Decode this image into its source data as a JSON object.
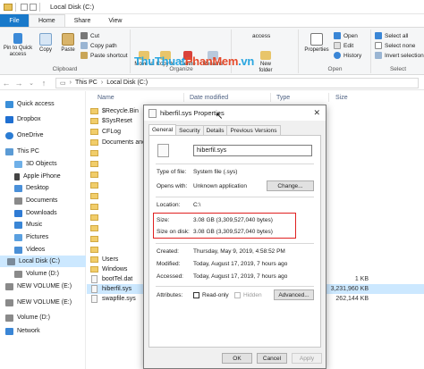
{
  "window": {
    "title": "Local Disk (C:)"
  },
  "ribbon_tabs": [
    "File",
    "Home",
    "Share",
    "View"
  ],
  "ribbon": {
    "clipboard": {
      "pin": "Pin to Quick access",
      "copy": "Copy",
      "paste": "Paste",
      "cut": "Cut",
      "copy_path": "Copy path",
      "paste_shortcut": "Paste shortcut",
      "label": "Clipboard"
    },
    "organize": {
      "move_to": "Move to",
      "copy_to": "Copy to",
      "delete": "Delete",
      "rename": "Rename",
      "label": "Organize"
    },
    "new": {
      "new_folder": "New folder",
      "easy_access": "access"
    },
    "open": {
      "properties": "Properties",
      "open": "Open",
      "edit": "Edit",
      "history": "History",
      "label": "Open"
    },
    "select": {
      "select_all": "Select all",
      "select_none": "Select none",
      "invert": "Invert selection",
      "label": "Select"
    },
    "watermark": {
      "a": "ThuThuat",
      "b": "PhanMem",
      "c": ".vn"
    }
  },
  "address": {
    "this_pc": "This PC",
    "local_disk": "Local Disk (C:)"
  },
  "nav": [
    {
      "label": "Quick access",
      "color": "#3b8fd9"
    },
    {
      "label": "Dropbox",
      "color": "#1f6fd1"
    },
    {
      "label": "OneDrive",
      "color": "#2b7cd3"
    },
    {
      "label": "This PC",
      "color": "#5b9bd5"
    },
    {
      "label": "3D Objects",
      "color": "#6fb0e8"
    },
    {
      "label": "Apple iPhone",
      "color": "#444444"
    },
    {
      "label": "Desktop",
      "color": "#4a90d9"
    },
    {
      "label": "Documents",
      "color": "#8a8a8a"
    },
    {
      "label": "Downloads",
      "color": "#2f7bd4"
    },
    {
      "label": "Music",
      "color": "#3a86d6"
    },
    {
      "label": "Pictures",
      "color": "#5aa0e0"
    },
    {
      "label": "Videos",
      "color": "#4a8fd6"
    },
    {
      "label": "Local Disk (C:)",
      "color": "#7a8a9a"
    },
    {
      "label": "Volume (D:)",
      "color": "#8a8a8a"
    },
    {
      "label": "NEW VOLUME (E:)",
      "color": "#8a8a8a"
    },
    {
      "label": "NEW VOLUME (E:)",
      "color": "#8a8a8a"
    },
    {
      "label": "Volume (D:)",
      "color": "#8a8a8a"
    },
    {
      "label": "Network",
      "color": "#3a86d6"
    }
  ],
  "columns": {
    "name": "Name",
    "date": "Date modified",
    "type": "Type",
    "size": "Size"
  },
  "files": [
    {
      "name": "$Recycle.Bin",
      "kind": "folder",
      "size": ""
    },
    {
      "name": "$SysReset",
      "kind": "folder",
      "size": ""
    },
    {
      "name": "CFLog",
      "kind": "folder",
      "size": ""
    },
    {
      "name": "Documents and Se",
      "kind": "folder",
      "size": ""
    },
    {
      "name": "",
      "kind": "folder",
      "size": ""
    },
    {
      "name": "",
      "kind": "folder",
      "size": ""
    },
    {
      "name": "",
      "kind": "folder",
      "size": ""
    },
    {
      "name": "",
      "kind": "folder",
      "size": ""
    },
    {
      "name": "",
      "kind": "folder",
      "size": ""
    },
    {
      "name": "",
      "kind": "folder",
      "size": ""
    },
    {
      "name": "",
      "kind": "folder",
      "size": ""
    },
    {
      "name": "",
      "kind": "folder",
      "size": ""
    },
    {
      "name": "",
      "kind": "folder",
      "size": ""
    },
    {
      "name": "",
      "kind": "folder",
      "size": ""
    },
    {
      "name": "Users",
      "kind": "folder",
      "size": ""
    },
    {
      "name": "Windows",
      "kind": "folder",
      "size": ""
    },
    {
      "name": "bootTel.dat",
      "kind": "file",
      "size": "1 KB"
    },
    {
      "name": "hiberfil.sys",
      "kind": "file",
      "size": "3,231,960 KB"
    },
    {
      "name": "swapfile.sys",
      "kind": "file",
      "size": "262,144 KB"
    }
  ],
  "dialog": {
    "title": "hiberfil.sys Properties",
    "close": "✕",
    "tabs": [
      "General",
      "Security",
      "Details",
      "Previous Versions"
    ],
    "filename": "hiberfil.sys",
    "type_label": "Type of file:",
    "type_value": "System file (.sys)",
    "opens_label": "Opens with:",
    "opens_value": "Unknown application",
    "change_btn": "Change...",
    "location_label": "Location:",
    "location_value": "C:\\",
    "size_label": "Size:",
    "size_value": "3.08 GB (3,309,527,040 bytes)",
    "disk_label": "Size on disk:",
    "disk_value": "3.08 GB (3,309,527,040 bytes)",
    "created_label": "Created:",
    "created_value": "Thursday, May 9, 2019, 4:58:52 PM",
    "modified_label": "Modified:",
    "modified_value": "Today, August 17, 2019, 7 hours ago",
    "accessed_label": "Accessed:",
    "accessed_value": "Today, August 17, 2019, 7 hours ago",
    "attributes_label": "Attributes:",
    "readonly": "Read-only",
    "hidden": "Hidden",
    "advanced_btn": "Advanced...",
    "ok": "OK",
    "cancel": "Cancel",
    "apply": "Apply"
  }
}
